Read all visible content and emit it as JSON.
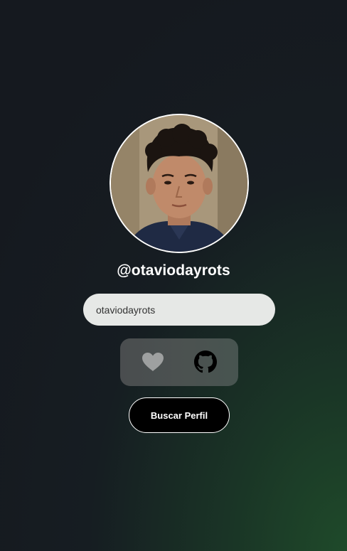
{
  "profile": {
    "username": "@otaviodayrots",
    "avatar_icon": "profile-photo"
  },
  "search": {
    "value": "otaviodayrots",
    "placeholder": ""
  },
  "actions": {
    "favorite_icon": "heart-icon",
    "github_icon": "github-icon",
    "heart_color": "#9ea0a0",
    "github_color": "#000000"
  },
  "search_button": {
    "label": "Buscar Perfil"
  },
  "colors": {
    "background_dark": "#15191f",
    "background_accent": "#1f4a2a",
    "input_bg": "#e6e8e6",
    "panel_bg": "#4a4f4f"
  }
}
